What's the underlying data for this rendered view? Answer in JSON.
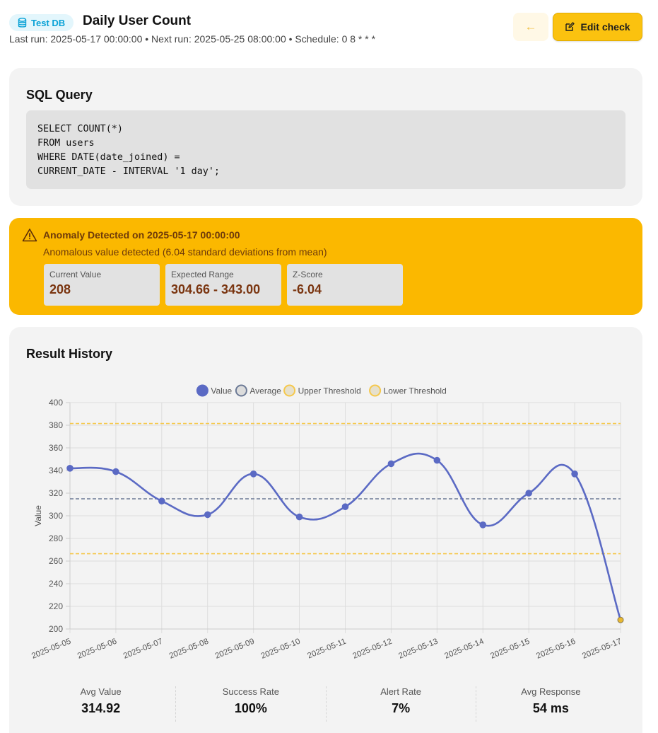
{
  "header": {
    "db_badge": "Test DB",
    "title": "Daily User Count",
    "meta": "Last run: 2025-05-17 00:00:00 • Next run: 2025-05-25 08:00:00 • Schedule: 0 8 * * *",
    "back_icon": "arrow-left-icon",
    "edit_label": "Edit check",
    "edit_icon": "edit-icon"
  },
  "sql": {
    "title": "SQL Query",
    "query": "SELECT COUNT(*)\nFROM users\nWHERE DATE(date_joined) =\nCURRENT_DATE - INTERVAL '1 day';"
  },
  "alert": {
    "icon": "warning-triangle-icon",
    "title": "Anomaly Detected on 2025-05-17 00:00:00",
    "subtitle": "Anomalous value detected (6.04 standard deviations from mean)",
    "stats": [
      {
        "label": "Current Value",
        "value": "208"
      },
      {
        "label": "Expected Range",
        "value": "304.66 - 343.00"
      },
      {
        "label": "Z-Score",
        "value": "-6.04"
      }
    ]
  },
  "history": {
    "title": "Result History",
    "summary": [
      {
        "label": "Avg Value",
        "value": "314.92"
      },
      {
        "label": "Success Rate",
        "value": "100%"
      },
      {
        "label": "Alert Rate",
        "value": "7%"
      },
      {
        "label": "Avg Response",
        "value": "54 ms"
      }
    ]
  },
  "colors": {
    "value_line": "#5b6ac4",
    "average_line": "#6c7a96",
    "threshold_line": "#f5c84c",
    "anomaly_point": "#e8b830"
  },
  "chart_data": {
    "type": "line",
    "ylabel": "Value",
    "ylim": [
      200,
      400
    ],
    "yticks": [
      200,
      220,
      240,
      260,
      280,
      300,
      320,
      340,
      360,
      380,
      400
    ],
    "grid": true,
    "legend_position": "top",
    "x": [
      "2025-05-05",
      "2025-05-06",
      "2025-05-07",
      "2025-05-08",
      "2025-05-09",
      "2025-05-10",
      "2025-05-11",
      "2025-05-12",
      "2025-05-13",
      "2025-05-14",
      "2025-05-15",
      "2025-05-16",
      "2025-05-17"
    ],
    "series": [
      {
        "name": "Value",
        "values": [
          342,
          339,
          313,
          301,
          337,
          299,
          308,
          346,
          349,
          292,
          320,
          337,
          208
        ]
      },
      {
        "name": "Average",
        "values": [
          315,
          315,
          315,
          315,
          315,
          315,
          315,
          315,
          315,
          315,
          315,
          315,
          315
        ]
      },
      {
        "name": "Upper Threshold",
        "values": [
          381.5,
          381.5,
          381.5,
          381.5,
          381.5,
          381.5,
          381.5,
          381.5,
          381.5,
          381.5,
          381.5,
          381.5,
          381.5
        ]
      },
      {
        "name": "Lower Threshold",
        "values": [
          266.5,
          266.5,
          266.5,
          266.5,
          266.5,
          266.5,
          266.5,
          266.5,
          266.5,
          266.5,
          266.5,
          266.5,
          266.5
        ]
      }
    ],
    "anomaly_index": 12
  }
}
